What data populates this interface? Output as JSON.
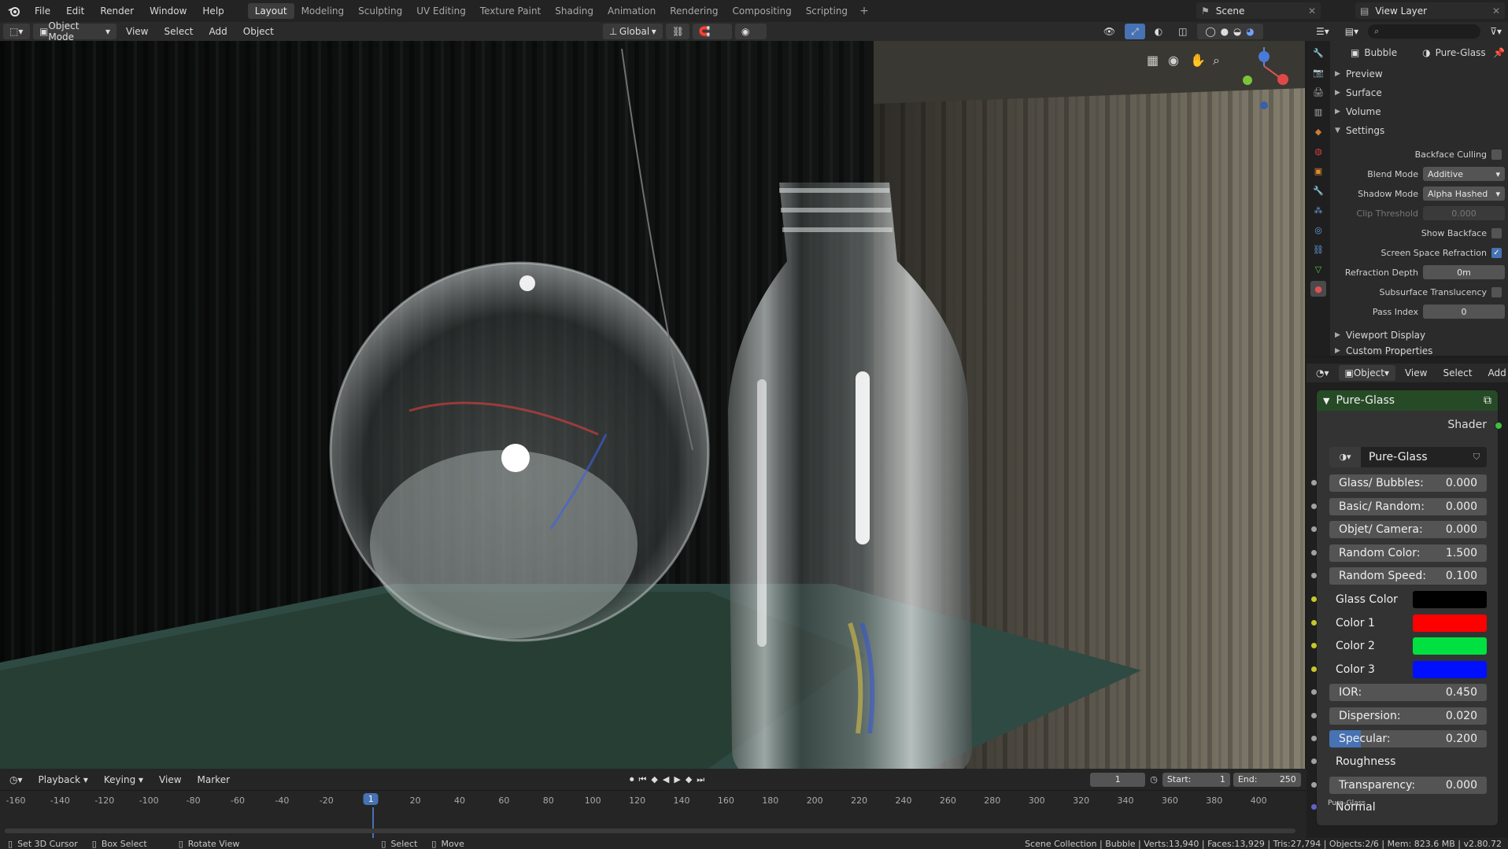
{
  "topbar": {
    "menus": [
      "File",
      "Edit",
      "Render",
      "Window",
      "Help"
    ],
    "workspaces": [
      "Layout",
      "Modeling",
      "Sculpting",
      "UV Editing",
      "Texture Paint",
      "Shading",
      "Animation",
      "Rendering",
      "Compositing",
      "Scripting"
    ],
    "active_workspace": "Layout",
    "add_tab": "+",
    "scene": "Scene",
    "view_layer": "View Layer"
  },
  "viewport_header": {
    "mode": "Object Mode",
    "menus": [
      "View",
      "Select",
      "Add",
      "Object"
    ],
    "transform_orientation": "Global"
  },
  "properties": {
    "object_name": "Bubble",
    "material_name": "Pure-Glass",
    "sections_top": [
      "Preview",
      "Surface",
      "Volume",
      "Settings"
    ],
    "settings": {
      "backface_culling_label": "Backface Culling",
      "blend_mode_label": "Blend Mode",
      "blend_mode": "Additive",
      "shadow_mode_label": "Shadow Mode",
      "shadow_mode": "Alpha Hashed",
      "clip_threshold_label": "Clip Threshold",
      "clip_threshold": "0.000",
      "show_backface_label": "Show Backface",
      "ssr_label": "Screen Space Refraction",
      "refraction_depth_label": "Refraction Depth",
      "refraction_depth": "0m",
      "subsurface_label": "Subsurface Translucency",
      "pass_index_label": "Pass Index",
      "pass_index": "0"
    },
    "sections_bottom": [
      "Viewport Display",
      "Custom Properties"
    ]
  },
  "node_editor_header": {
    "context": "Object",
    "menus": [
      "View",
      "Select",
      "Add"
    ]
  },
  "node": {
    "title": "Pure-Glass",
    "output": "Shader",
    "group_name": "Pure-Glass",
    "inputs": [
      {
        "label": "Glass/ Bubbles:",
        "value": "0.000"
      },
      {
        "label": "Basic/ Random:",
        "value": "0.000"
      },
      {
        "label": "Objet/ Camera:",
        "value": "0.000"
      },
      {
        "label": "Random Color:",
        "value": "1.500"
      },
      {
        "label": "Random Speed:",
        "value": "0.100"
      }
    ],
    "colors": [
      {
        "label": "Glass Color",
        "color": "#000000"
      },
      {
        "label": "Color 1",
        "color": "#ff0000"
      },
      {
        "label": "Color 2",
        "color": "#00e040"
      },
      {
        "label": "Color 3",
        "color": "#0010ff"
      }
    ],
    "inputs2": [
      {
        "label": "IOR:",
        "value": "0.450"
      },
      {
        "label": "Dispersion:",
        "value": "0.020"
      },
      {
        "label": "Specular:",
        "value": "0.200"
      }
    ],
    "roughness_label": "Roughness",
    "transparency": {
      "label": "Transparency:",
      "value": "0.000"
    },
    "normal_label": "Normal",
    "tooltip_fragment": "Pure-Glass"
  },
  "timeline": {
    "menus": [
      "Playback",
      "Keying",
      "View",
      "Marker"
    ],
    "current_frame": "1",
    "start_label": "Start:",
    "start": "1",
    "end_label": "End:",
    "end": "250",
    "ticks": [
      "-160",
      "-140",
      "-120",
      "-100",
      "-80",
      "-60",
      "-40",
      "-20",
      "1",
      "20",
      "40",
      "60",
      "80",
      "100",
      "120",
      "140",
      "160",
      "180",
      "200",
      "220",
      "240",
      "260",
      "280",
      "300",
      "320",
      "340",
      "360",
      "380",
      "400"
    ]
  },
  "statusbar": {
    "hints": [
      "Set 3D Cursor",
      "Box Select",
      "Rotate View",
      "Select",
      "Move"
    ],
    "info": "Scene Collection | Bubble | Verts:13,940 | Faces:13,929 | Tris:27,794 | Objects:2/6 | Mem: 823.6 MB | v2.80.72"
  }
}
